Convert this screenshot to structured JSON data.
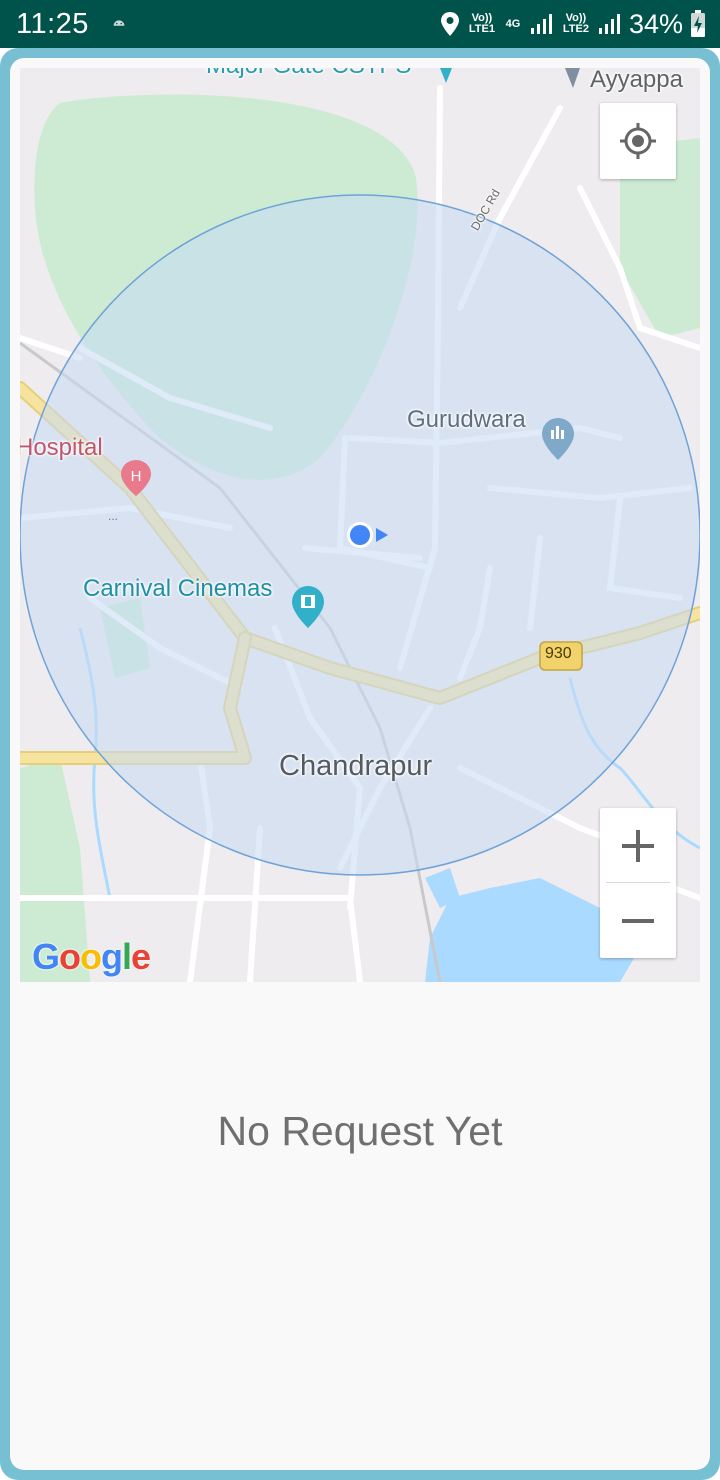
{
  "status_bar": {
    "time": "11:25",
    "network_1": "Vo)) LTE1",
    "network_type": "4G",
    "network_2": "Vo)) LTE2",
    "battery": "34%"
  },
  "map": {
    "labels": {
      "major_gate": "Major Gate CSTPS",
      "ayyappa": "Ayyappa",
      "doc_rd": "DOC Rd",
      "gurudwara": "Gurudwara",
      "hospital": "Hospital",
      "carnival": "Carnival Cinemas",
      "route_930": "930",
      "chandrapur": "Chandrapur"
    },
    "icons": {
      "locate": "my-location-icon",
      "zoom_in": "plus-icon",
      "zoom_out": "minus-icon",
      "hospital": "hospital-pin-icon",
      "gurudwara": "place-of-worship-pin-icon",
      "cinema": "movie-pin-icon",
      "user": "user-location-dot-icon"
    },
    "attribution": "Google",
    "colors": {
      "park": "#cdebd2",
      "water": "#aadaff",
      "highway": "#f6e3a0",
      "radius_fill": "#c6dbf4",
      "radius_stroke": "#6fa3d8",
      "user_dot": "#4285f4"
    }
  },
  "content": {
    "empty_message": "No Request Yet"
  },
  "colors": {
    "status_bar": "#00534a",
    "frame": "#77c0d4",
    "card": "#f9f9f9"
  }
}
